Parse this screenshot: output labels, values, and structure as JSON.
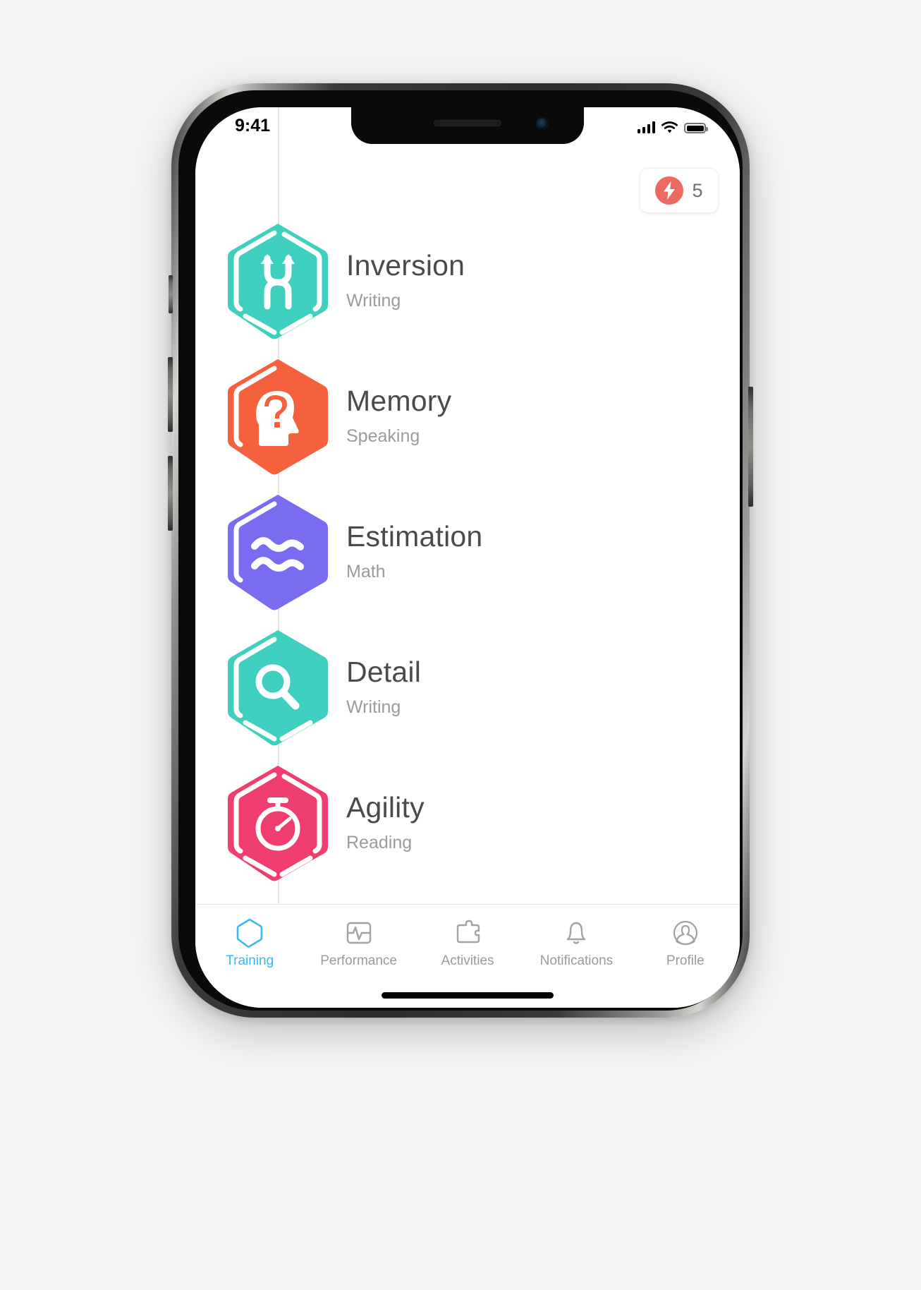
{
  "app": {
    "name": "Training",
    "background_color": "#f4f4f4",
    "accent_color": "#39b9f2"
  },
  "status_bar": {
    "time": "9:41",
    "signal_icon": "cellular-signal-icon",
    "signal_bars": 4,
    "wifi_icon": "wifi-icon",
    "battery_icon": "battery-full-icon",
    "battery_level": "100"
  },
  "header": {
    "streak": {
      "icon": "lightning-bolt-icon",
      "count": "5",
      "badge_color": "#ed6a5e"
    }
  },
  "skills": [
    {
      "title": "Inversion",
      "category": "Writing",
      "icon": "inversion-arrows-icon",
      "color": "#3fcfbe"
    },
    {
      "title": "Memory",
      "category": "Speaking",
      "icon": "head-question-icon",
      "color": "#f4613c"
    },
    {
      "title": "Estimation",
      "category": "Math",
      "icon": "approximately-equal-icon",
      "color": "#7a6cf0"
    },
    {
      "title": "Detail",
      "category": "Writing",
      "icon": "magnifying-glass-icon",
      "color": "#3fcfbe"
    },
    {
      "title": "Agility",
      "category": "Reading",
      "icon": "stopwatch-icon",
      "color": "#ef3d70"
    }
  ],
  "tab_bar": {
    "active_index": 0,
    "items": [
      {
        "label": "Training",
        "icon": "hexagon-icon"
      },
      {
        "label": "Performance",
        "icon": "chart-pulse-icon"
      },
      {
        "label": "Activities",
        "icon": "puzzle-piece-icon"
      },
      {
        "label": "Notifications",
        "icon": "bell-icon"
      },
      {
        "label": "Profile",
        "icon": "user-circle-icon"
      }
    ]
  }
}
